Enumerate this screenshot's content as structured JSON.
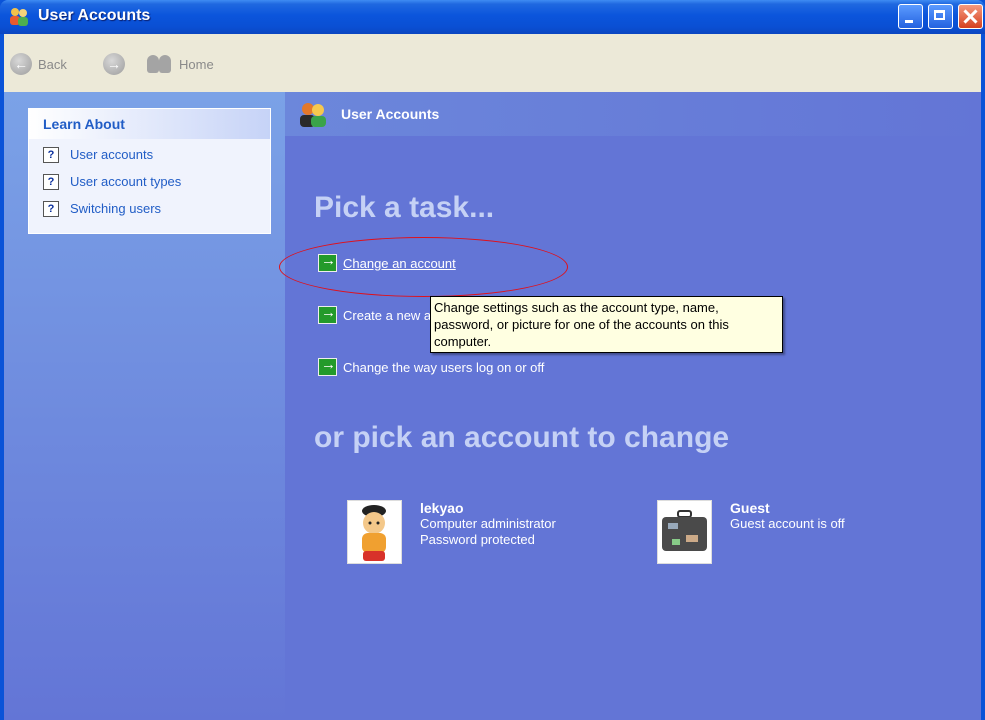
{
  "window": {
    "title": "User Accounts",
    "icon": "users-icon",
    "controls": [
      "minimize-icon",
      "maximize-icon",
      "close-icon"
    ]
  },
  "toolbar": {
    "back_label": "Back",
    "home_label": "Home"
  },
  "sidebar": {
    "header": "Learn About",
    "items": [
      {
        "label": "User accounts",
        "icon": "help-icon"
      },
      {
        "label": "User account types",
        "icon": "help-icon"
      },
      {
        "label": "Switching users",
        "icon": "help-icon"
      }
    ]
  },
  "main": {
    "header_title": "User Accounts",
    "pick_task_heading": "Pick a task...",
    "tasks": [
      {
        "label": "Change an account"
      },
      {
        "label": "Create a new account"
      },
      {
        "label": "Change the way users log on or off"
      }
    ],
    "pick_account_heading": "or pick an account to change",
    "accounts": [
      {
        "name": "lekyao",
        "line1": "Computer administrator",
        "line2": "Password protected"
      },
      {
        "name": "Guest",
        "line1": "Guest account is off",
        "line2": ""
      }
    ]
  },
  "tooltip": {
    "text": "Change settings such as the account type, name, password, or picture for one of the accounts on this computer."
  },
  "colors": {
    "titlebar": "#0a53d8",
    "main_bg": "#6375d6",
    "heading_text": "#c5d1f5",
    "annotation": "#e0101a"
  }
}
